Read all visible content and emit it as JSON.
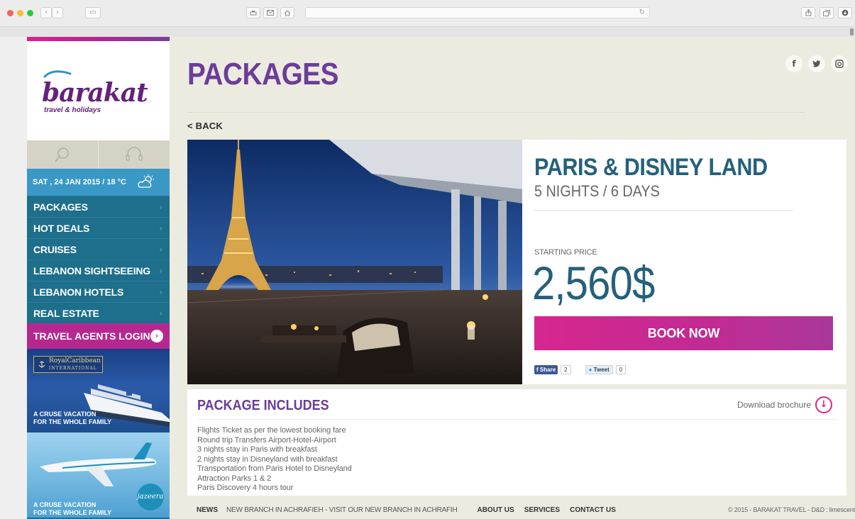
{
  "browser": {
    "reload_glyph": "↻",
    "nav": {
      "back": "‹",
      "forward": "›",
      "sidebar": "▭"
    },
    "toolbar": [
      "print",
      "mail",
      "home"
    ],
    "right_icons": [
      "share",
      "tabs",
      "download"
    ]
  },
  "sidebar": {
    "logo": {
      "word": "barakat",
      "sub": "travel & holidays"
    },
    "icons": [
      "search-icon",
      "headset-icon"
    ],
    "weather": "SAT , 24 JAN 2015 / 18 °C",
    "nav_items": [
      {
        "label": "PACKAGES"
      },
      {
        "label": "HOT DEALS"
      },
      {
        "label": "CRUISES"
      },
      {
        "label": "LEBANON SIGHTSEEING"
      },
      {
        "label": "LEBANON HOTELS"
      },
      {
        "label": "REAL ESTATE"
      }
    ],
    "agents_login": "TRAVEL AGENTS LOGIN",
    "ad1": {
      "brand": "RoyalCaribbean",
      "brand_sub": "INTERNATIONAL",
      "line1": "A CRUSE VACATION",
      "line2": "FOR THE WHOLE FAMILY"
    },
    "ad2": {
      "brand": "jazeera",
      "line1": "A CRUSE VACATION",
      "line2": "FOR THE WHOLE FAMILY"
    }
  },
  "main": {
    "title": "PACKAGES",
    "social": [
      "f",
      "t",
      "◎"
    ],
    "back": "< BACK",
    "package": {
      "title": "PARIS & DISNEY LAND",
      "duration": "5 NIGHTS / 6 DAYS",
      "price_label": "STARTING PRICE",
      "price": "2,560$",
      "book": "BOOK NOW",
      "fb_share": "Share",
      "fb_count": "2",
      "tweet": "Tweet",
      "tweet_count": "0"
    },
    "includes": {
      "title": "PACKAGE INCLUDES",
      "download": "Download brochure",
      "items": [
        "Flights Ticket as per the lowest booking fare",
        "Round trip Transfers Airport-Hotel-Airport",
        "3 nights stay in Paris with breakfast",
        "2 nights stay in Disneyland with breakfast",
        "Transportation from Paris Hotel to Disneyland",
        "Attraction Parks 1 & 2",
        "Paris Discovery 4 hours tour"
      ]
    }
  },
  "footer": {
    "news_label": "NEWS",
    "news_text": "NEW BRANCH IN ACHRAFIEH - VISIT OUR NEW BRANCH IN ACHRAFIH",
    "links": [
      "ABOUT US",
      "SERVICES",
      "CONTACT US"
    ],
    "copyright": "© 2015 - BARAKAT TRAVEL - D&D : limescent"
  },
  "colors": {
    "brand_purple": "#6b3d99",
    "teal_nav": "#1d6f8c",
    "price_blue": "#24607c",
    "magenta": "#d7268f"
  }
}
